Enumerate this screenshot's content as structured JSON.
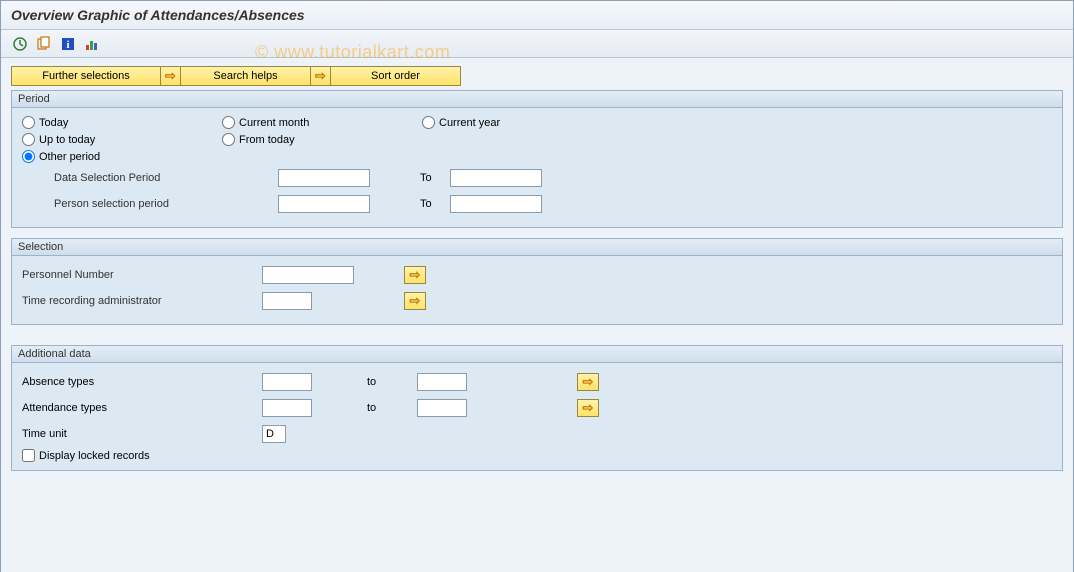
{
  "title": "Overview Graphic of Attendances/Absences",
  "watermark": "© www.tutorialkart.com",
  "buttons": {
    "further": "Further selections",
    "search_helps": "Search helps",
    "sort_order": "Sort order"
  },
  "period": {
    "title": "Period",
    "today": "Today",
    "current_month": "Current month",
    "current_year": "Current year",
    "up_to_today": "Up to today",
    "from_today": "From today",
    "other_period": "Other period",
    "data_selection_period": "Data Selection Period",
    "person_selection_period": "Person selection period",
    "to": "To",
    "data_from_val": "",
    "data_to_val": "",
    "person_from_val": "",
    "person_to_val": ""
  },
  "selection": {
    "title": "Selection",
    "personnel_number": "Personnel Number",
    "time_admin": "Time recording administrator",
    "pn_val": "",
    "ta_val": ""
  },
  "additional": {
    "title": "Additional data",
    "absence_types": "Absence types",
    "attendance_types": "Attendance types",
    "time_unit": "Time unit",
    "display_locked": "Display locked records",
    "to": "to",
    "absence_from_val": "",
    "absence_to_val": "",
    "attendance_from_val": "",
    "attendance_to_val": "",
    "time_unit_val": "D"
  }
}
